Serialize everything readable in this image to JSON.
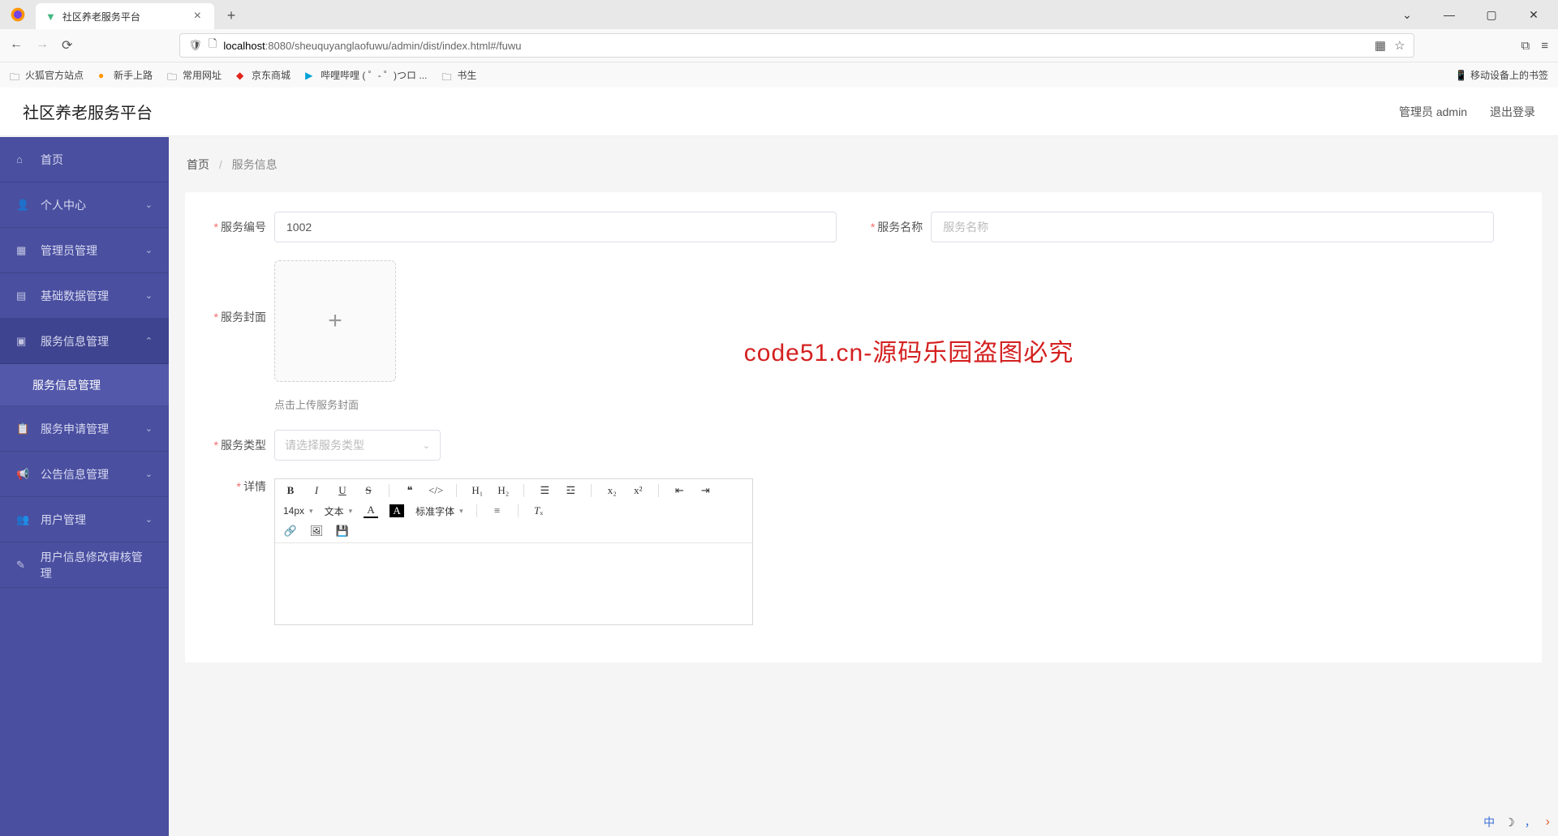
{
  "browser": {
    "tab_title": "社区养老服务平台",
    "url_prefix": "localhost",
    "url_rest": ":8080/sheuquyanglaofuwu/admin/dist/index.html#/fuwu",
    "window_controls": {
      "chevron": "⌄",
      "min": "—",
      "max": "▢",
      "close": "✕"
    },
    "bookmarks": {
      "b1": "火狐官方站点",
      "b2": "新手上路",
      "b3": "常用网址",
      "b4": "京东商城",
      "b5": "哔哩哔哩 (  ゜- ゜)つロ ...",
      "b6": "书生",
      "right": "移动设备上的书签"
    }
  },
  "app": {
    "title": "社区养老服务平台",
    "user_label": "管理员 admin",
    "logout": "退出登录"
  },
  "sidebar": {
    "items": [
      {
        "icon": "home",
        "label": "首页",
        "expandable": false
      },
      {
        "icon": "user",
        "label": "个人中心",
        "expandable": true,
        "open": false
      },
      {
        "icon": "admin",
        "label": "管理员管理",
        "expandable": true,
        "open": false
      },
      {
        "icon": "data",
        "label": "基础数据管理",
        "expandable": true,
        "open": false
      },
      {
        "icon": "service",
        "label": "服务信息管理",
        "expandable": true,
        "open": true,
        "children": [
          {
            "label": "服务信息管理"
          }
        ]
      },
      {
        "icon": "apply",
        "label": "服务申请管理",
        "expandable": true,
        "open": false
      },
      {
        "icon": "announce",
        "label": "公告信息管理",
        "expandable": true,
        "open": false
      },
      {
        "icon": "users",
        "label": "用户管理",
        "expandable": true,
        "open": false
      },
      {
        "icon": "audit",
        "label": "用户信息修改审核管理",
        "expandable": false
      }
    ]
  },
  "breadcrumb": {
    "home": "首页",
    "current": "服务信息"
  },
  "form": {
    "service_no": {
      "label": "服务编号",
      "value": "1002"
    },
    "service_name": {
      "label": "服务名称",
      "placeholder": "服务名称",
      "value": ""
    },
    "cover": {
      "label": "服务封面",
      "hint": "点击上传服务封面"
    },
    "service_type": {
      "label": "服务类型",
      "placeholder": "请选择服务类型"
    },
    "detail": {
      "label": "详情"
    }
  },
  "editor": {
    "font_size": "14px",
    "format": "文本",
    "font_family": "标准字体"
  },
  "watermark": "code51.cn-源码乐园盗图必究",
  "ime": {
    "lang": "中",
    "moon": "☽"
  }
}
